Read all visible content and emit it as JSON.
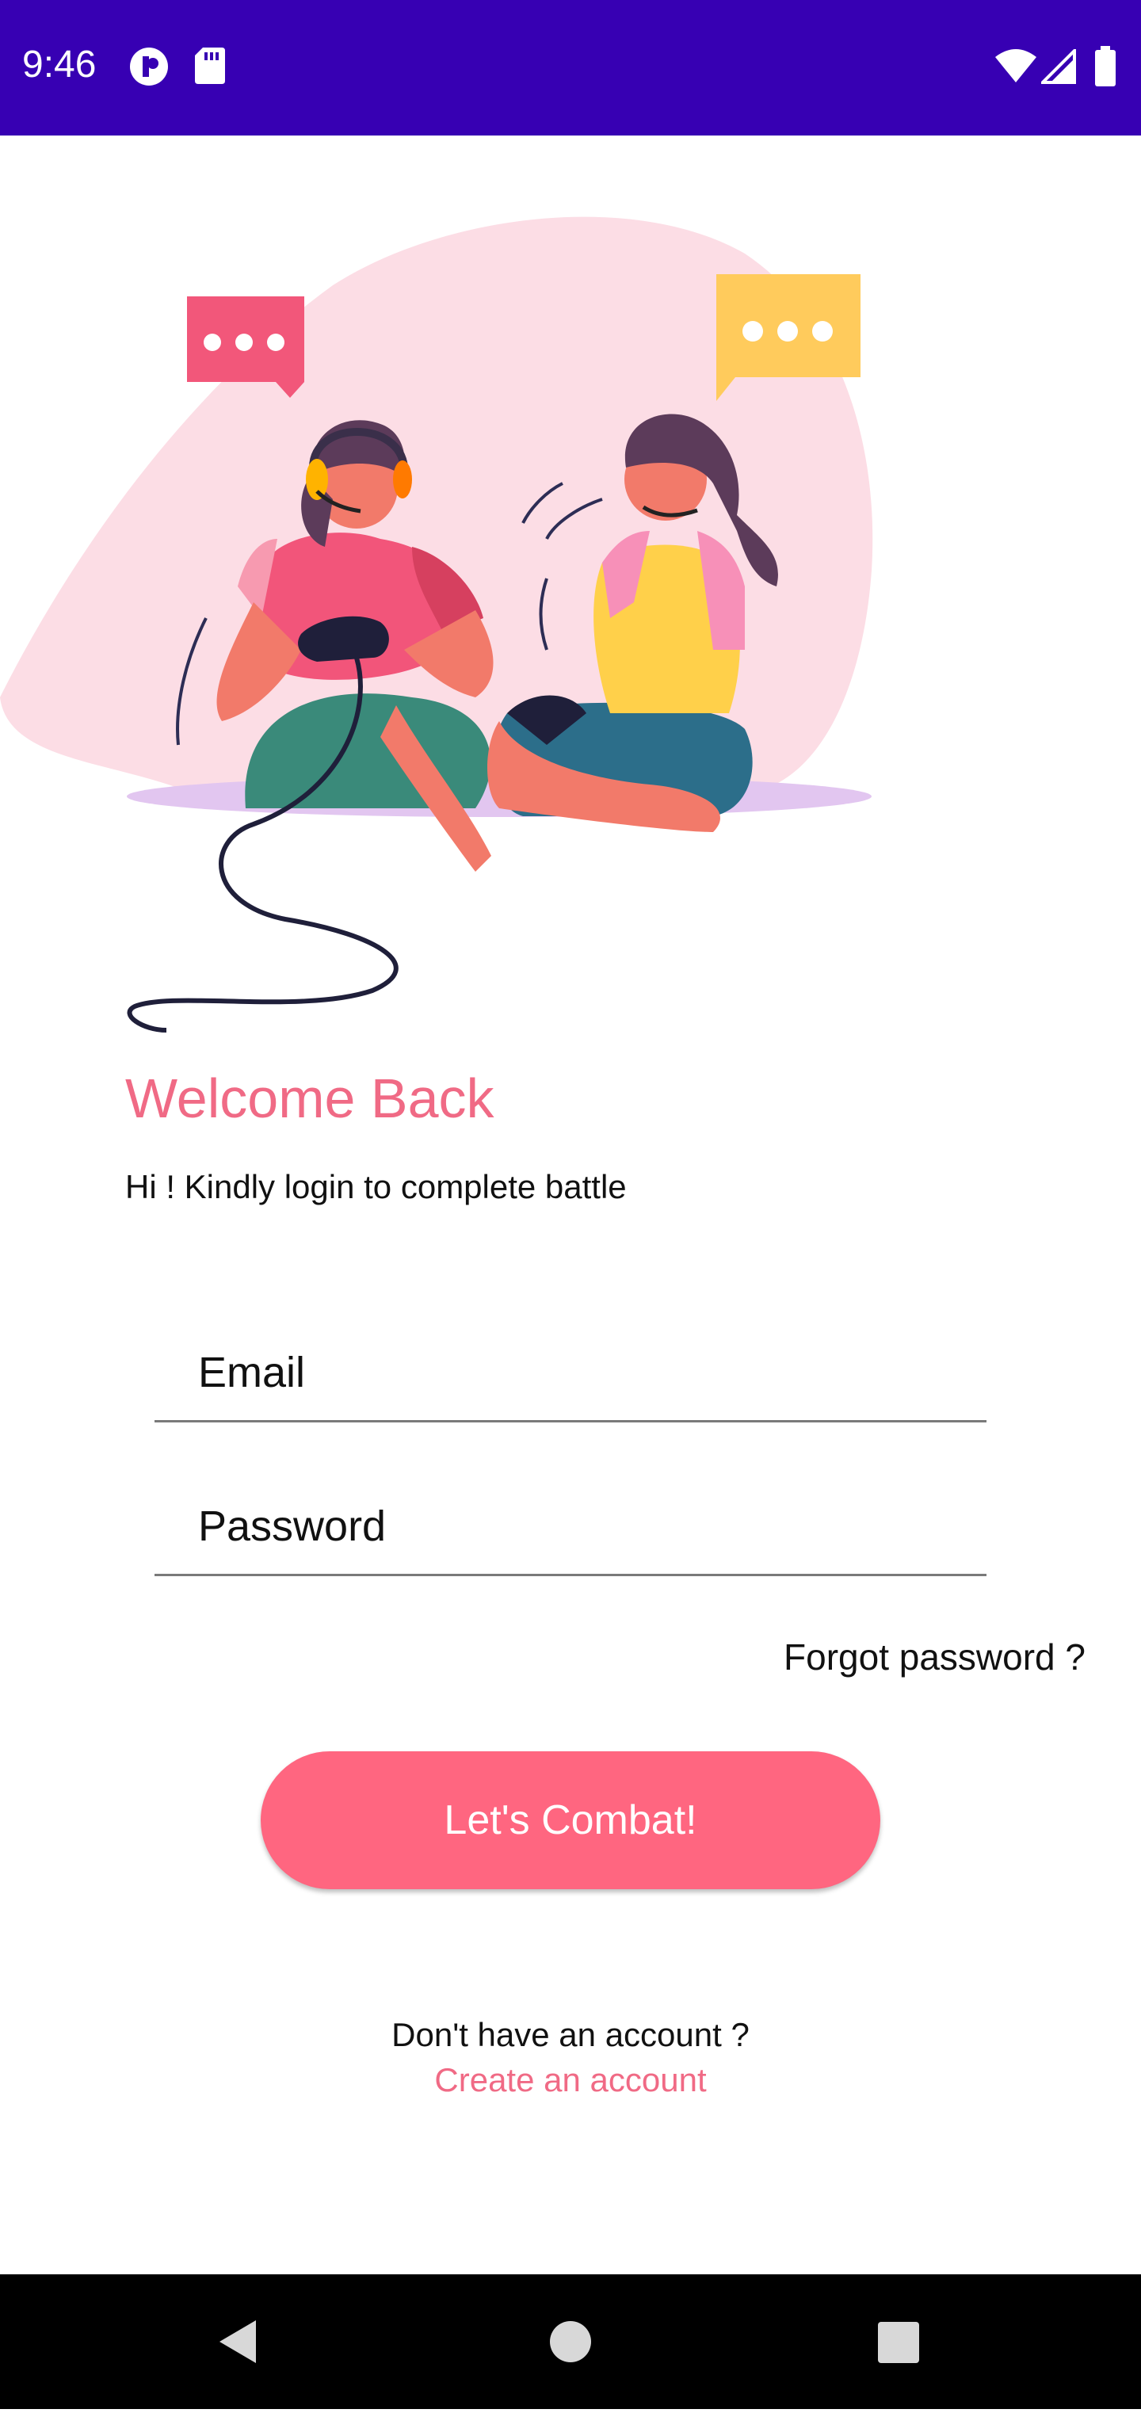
{
  "status_bar": {
    "time": "9:46",
    "background": "#3700b3"
  },
  "login": {
    "title": "Welcome Back",
    "subtitle": "Hi ! Kindly login to complete battle",
    "email_placeholder": "Email",
    "password_placeholder": "Password",
    "forgot_label": "Forgot password ?",
    "submit_label": "Let's Combat!",
    "no_account_label": "Don't have an account ?",
    "create_account_label": "Create an account"
  },
  "colors": {
    "accent": "#ff6680",
    "title": "#f06a85"
  },
  "icons": {
    "status_left": [
      "notification-app-icon",
      "sd-card-icon"
    ],
    "status_right": [
      "wifi-icon",
      "cellular-signal-icon",
      "battery-icon"
    ],
    "nav": [
      "back-icon",
      "home-icon",
      "recents-icon"
    ]
  }
}
